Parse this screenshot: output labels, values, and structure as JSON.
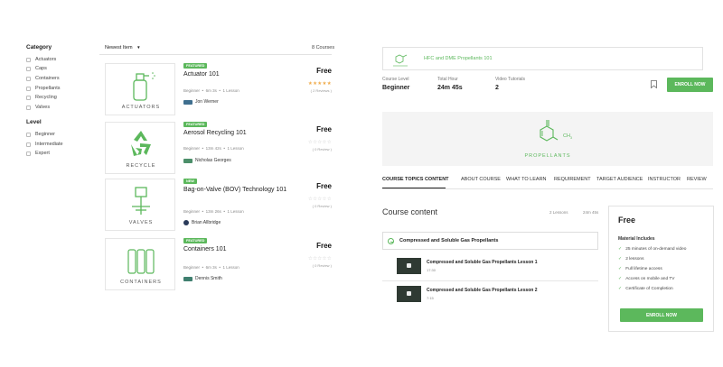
{
  "filters": {
    "category_title": "Category",
    "categories": [
      "Actuators",
      "Caps",
      "Containers",
      "Propellants",
      "Recycling",
      "Valves"
    ],
    "level_title": "Level",
    "levels": [
      "Beginner",
      "Intermediate",
      "Expert"
    ]
  },
  "listing": {
    "sort_label": "Newest Item",
    "sort_icon": "caret-down-icon",
    "count": "8 Courses"
  },
  "courses": [
    {
      "thumb_label": "ACTUATORS",
      "badge": "FEATURED",
      "title": "Actuator 101",
      "level": "Beginner",
      "duration": "6m 3s",
      "lessons": "1 Lesson",
      "author": "Jon Werner",
      "price": "Free",
      "stars": "★★★★★",
      "reviews": "( 2 Reviews )",
      "author_color": "#3f6f8f"
    },
    {
      "thumb_label": "RECYCLE",
      "badge": "FEATURED",
      "title": "Aerosol Recycling 101",
      "level": "Beginner",
      "duration": "13m 42s",
      "lessons": "1 Lesson",
      "author": "Nicholas Georges",
      "price": "Free",
      "stars": "☆☆☆☆☆",
      "reviews": "( 0 Review )",
      "author_color": "#4c8f6a"
    },
    {
      "thumb_label": "VALVES",
      "badge": "NEW",
      "title": "Bag-on-Valve (BOV) Technology 101",
      "level": "Beginner",
      "duration": "13m 26s",
      "lessons": "1 Lesson",
      "author": "Brian Allbridge",
      "price": "Free",
      "stars": "☆☆☆☆☆",
      "reviews": "( 0 Review )",
      "author_color": "#2a3a5a"
    },
    {
      "thumb_label": "CONTAINERS",
      "badge": "FEATURED",
      "title": "Containers 101",
      "level": "Beginner",
      "duration": "6m 3s",
      "lessons": "1 Lesson",
      "author": "Dennis Smith",
      "price": "Free",
      "stars": "☆☆☆☆☆",
      "reviews": "( 0 Review )",
      "author_color": "#3f7f6f"
    }
  ],
  "detail": {
    "top_card_title": "HFC and DME Propellants 101",
    "stats": [
      {
        "label": "Course Level",
        "value": "Beginner"
      },
      {
        "label": "Total Hour",
        "value": "24m 45s"
      },
      {
        "label": "Video Tutorials",
        "value": "2"
      }
    ],
    "enroll_label": "ENROLL NOW",
    "bookmark_icon": "bookmark-icon",
    "banner_label": "PROPELLANTS",
    "banner_chem": "CH",
    "banner_chem_sub": "3",
    "tabs": [
      "COURSE TOPICS CONTENT",
      "ABOUT COURSE",
      "WHAT TO LEARN",
      "REQUIREMENT",
      "TARGET AUDIENCE",
      "INSTRUCTOR",
      "REVIEW"
    ],
    "course_content_title": "Course content",
    "lessons_count": "2 Lessons",
    "total_time": "24m 45s",
    "section_title": "Compressed and Soluble Gas Propellants",
    "lessons": [
      {
        "title": "Compressed and Soluble Gas Propellants Lesson 1",
        "duration": "17:30"
      },
      {
        "title": "Compressed and Soluble Gas Propellants Lesson 2",
        "duration": "7:15"
      }
    ],
    "sidebar": {
      "price": "Free",
      "includes_title": "Material Includes",
      "includes": [
        "25 minutes of on-demand video",
        "2 lessons",
        "Full lifetime access",
        "Access on mobile and TV",
        "Certificate of Completion"
      ]
    }
  },
  "colors": {
    "accent": "#5cb85c",
    "star": "#f0ad4e"
  }
}
